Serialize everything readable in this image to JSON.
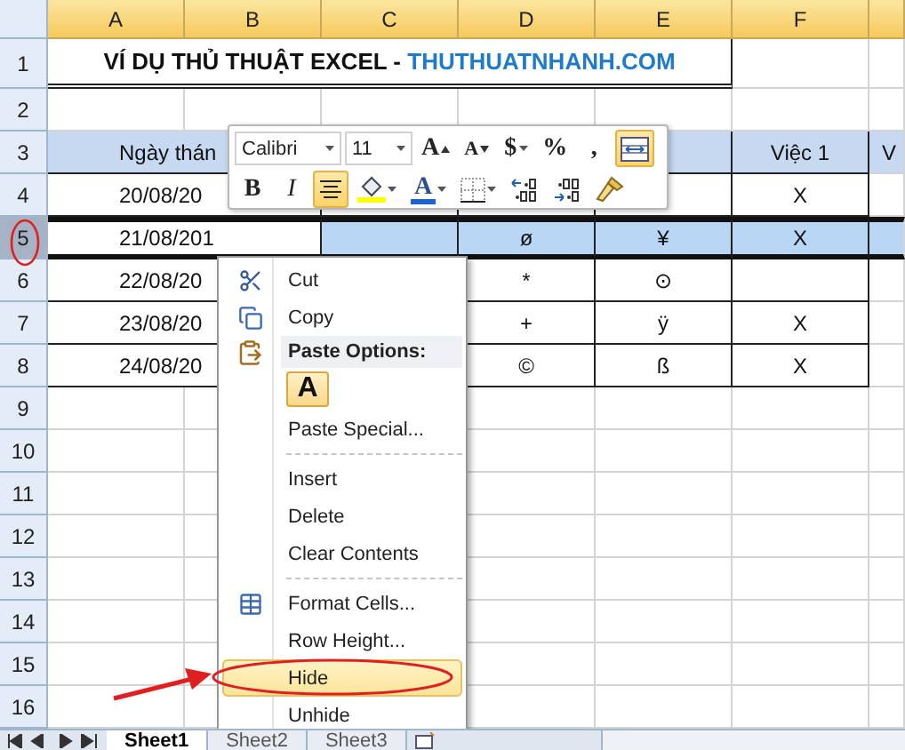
{
  "columns": [
    {
      "label": "A",
      "selected": true
    },
    {
      "label": "B",
      "selected": true
    },
    {
      "label": "C",
      "selected": true
    },
    {
      "label": "D",
      "selected": true
    },
    {
      "label": "E",
      "selected": true
    },
    {
      "label": "F",
      "selected": true
    }
  ],
  "rows": [
    {
      "number": "1",
      "kind": "title",
      "selected": false,
      "title": "VÍ DỤ THỦ THUẬT EXCEL - ",
      "title_link": "THUTHUATNHANH.COM"
    },
    {
      "number": "2",
      "kind": "blank",
      "selected": false
    },
    {
      "number": "3",
      "kind": "header",
      "selected": false,
      "cells": {
        "AB": "Ngày thán",
        "F": "Việc 1",
        "G": "V"
      }
    },
    {
      "number": "4",
      "kind": "data",
      "selected": false,
      "cells": {
        "AB": "20/08/20",
        "F": "X"
      }
    },
    {
      "number": "5",
      "kind": "data",
      "selected": true,
      "cells": {
        "AB": "21/08/201",
        "D": "ø",
        "E": "¥",
        "F": "X"
      }
    },
    {
      "number": "6",
      "kind": "data",
      "selected": false,
      "cells": {
        "AB": "22/08/20",
        "D": "*",
        "E": "⊙"
      }
    },
    {
      "number": "7",
      "kind": "data",
      "selected": false,
      "cells": {
        "AB": "23/08/20",
        "D": "+",
        "E": "ÿ",
        "F": "X"
      }
    },
    {
      "number": "8",
      "kind": "data",
      "selected": false,
      "cells": {
        "AB": "24/08/20",
        "D": "©",
        "E": "ß",
        "F": "X"
      }
    },
    {
      "number": "9",
      "kind": "blank",
      "selected": false
    },
    {
      "number": "10",
      "kind": "blank",
      "selected": false
    },
    {
      "number": "11",
      "kind": "blank",
      "selected": false
    },
    {
      "number": "12",
      "kind": "blank",
      "selected": false
    },
    {
      "number": "13",
      "kind": "blank",
      "selected": false
    },
    {
      "number": "14",
      "kind": "blank",
      "selected": false
    },
    {
      "number": "15",
      "kind": "blank",
      "selected": false
    },
    {
      "number": "16",
      "kind": "blank",
      "selected": false
    }
  ],
  "mini_toolbar": {
    "row_1": [
      {
        "kind": "font",
        "value": "Calibri"
      },
      {
        "kind": "size",
        "value": "11"
      },
      {
        "kind": "grow",
        "text": "A",
        "selected": false
      },
      {
        "kind": "shrink",
        "text": "A",
        "selected": false
      },
      {
        "kind": "currency",
        "text": "$",
        "selected": false
      },
      {
        "kind": "glyph",
        "text": "%",
        "selected": false
      },
      {
        "kind": "glyph",
        "text": ",",
        "selected": false
      },
      {
        "kind": "merge",
        "selected": true
      }
    ],
    "row_2": [
      {
        "kind": "bold",
        "text": "B",
        "selected": false
      },
      {
        "kind": "italic",
        "text": "I",
        "selected": false
      },
      {
        "kind": "center",
        "selected": true
      },
      {
        "kind": "fill",
        "selected": false
      },
      {
        "kind": "fontcolor",
        "text": "A",
        "selected": false
      },
      {
        "kind": "borders",
        "selected": false
      },
      {
        "kind": "increase",
        "selected": false
      },
      {
        "kind": "decrease",
        "selected": false
      },
      {
        "kind": "painter",
        "selected": false
      }
    ]
  },
  "context_menu": [
    {
      "kind": "command",
      "label": "Cut",
      "selected": false
    },
    {
      "kind": "command",
      "label": "Copy",
      "selected": false
    },
    {
      "kind": "section",
      "label": "Paste Options:"
    },
    {
      "kind": "paste_button",
      "label": "A"
    },
    {
      "kind": "command",
      "label": "Paste Special...",
      "selected": false
    },
    {
      "kind": "separator"
    },
    {
      "kind": "command",
      "label": "Insert",
      "selected": false
    },
    {
      "kind": "command",
      "label": "Delete",
      "selected": false
    },
    {
      "kind": "command",
      "label": "Clear Contents",
      "selected": false
    },
    {
      "kind": "separator"
    },
    {
      "kind": "command",
      "label": "Format Cells...",
      "selected": false
    },
    {
      "kind": "command",
      "label": "Row Height...",
      "selected": false
    },
    {
      "kind": "command",
      "label": "Hide",
      "selected": true
    },
    {
      "kind": "command",
      "label": "Unhide",
      "selected": false
    }
  ],
  "sheet_tabs": [
    {
      "label": "Sheet1",
      "selected": true
    },
    {
      "label": "Sheet2",
      "selected": false
    },
    {
      "label": "Sheet3",
      "selected": false
    }
  ]
}
